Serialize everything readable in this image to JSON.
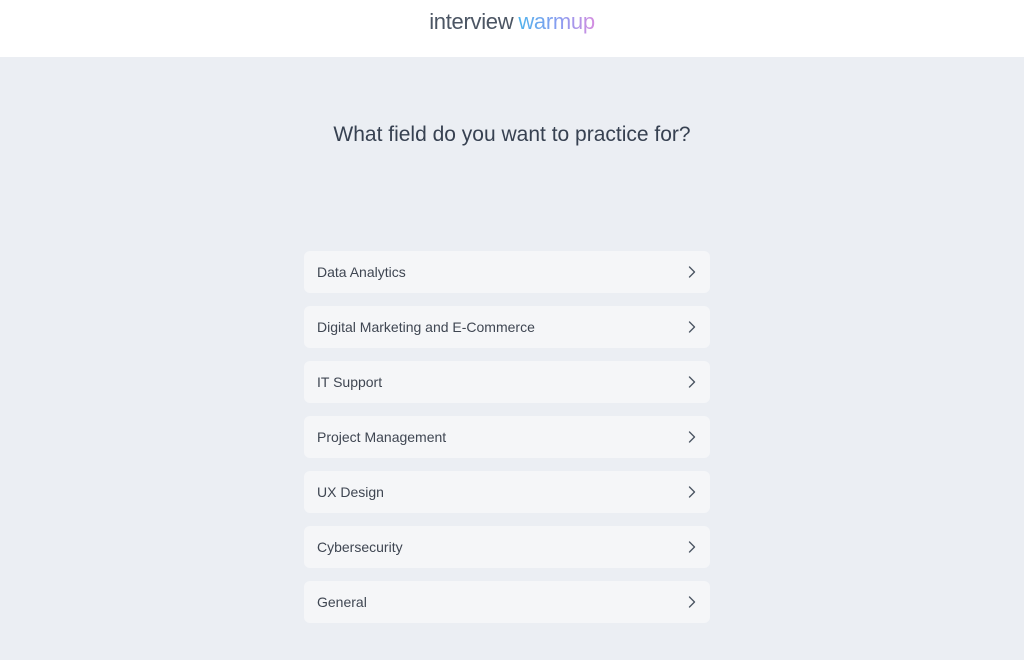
{
  "header": {
    "logo_part1": "interview",
    "logo_part2": "warmup"
  },
  "main": {
    "question": "What field do you want to practice for?",
    "options": [
      {
        "label": "Data Analytics",
        "icon": "chevron-right-icon"
      },
      {
        "label": "Digital Marketing and E-Commerce",
        "icon": "chevron-right-icon"
      },
      {
        "label": "IT Support",
        "icon": "chevron-right-icon"
      },
      {
        "label": "Project Management",
        "icon": "chevron-right-icon"
      },
      {
        "label": "UX Design",
        "icon": "chevron-right-icon"
      },
      {
        "label": "Cybersecurity",
        "icon": "chevron-right-icon"
      },
      {
        "label": "General",
        "icon": "chevron-right-icon"
      }
    ]
  },
  "colors": {
    "background": "#ebeef3",
    "header_bg": "#ffffff",
    "option_bg": "#f5f6f8",
    "text": "#374151",
    "logo_gradient_start": "#4fb3ec",
    "logo_gradient_end": "#d58de0"
  }
}
